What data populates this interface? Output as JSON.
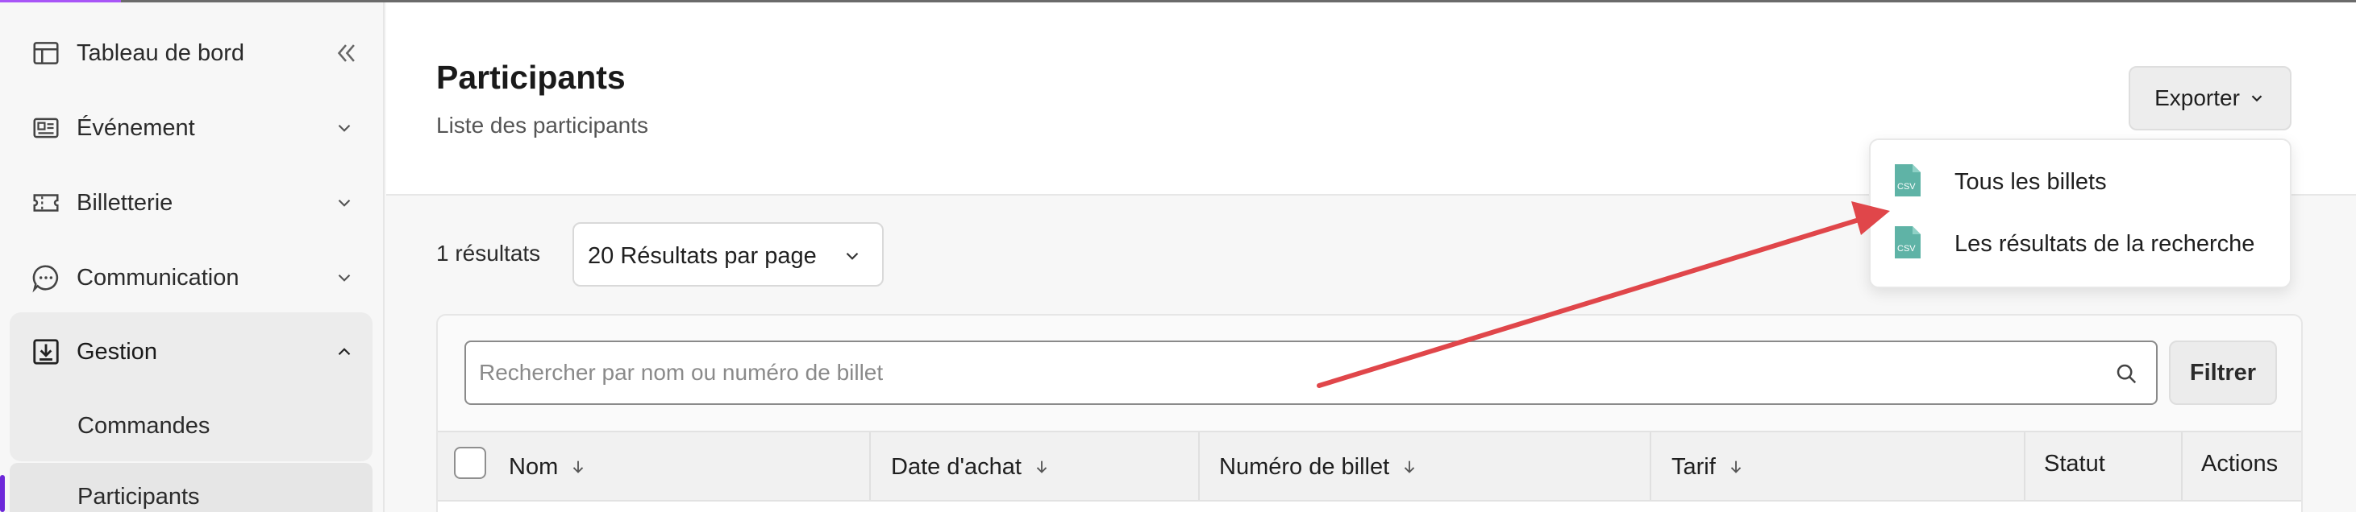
{
  "sidebar": {
    "items": [
      {
        "label": "Tableau de bord",
        "icon": "layout-icon"
      },
      {
        "label": "Événement",
        "icon": "id-card-icon"
      },
      {
        "label": "Billetterie",
        "icon": "ticket-icon"
      },
      {
        "label": "Communication",
        "icon": "chat-icon"
      },
      {
        "label": "Gestion",
        "icon": "download-box-icon"
      }
    ],
    "sub_items": [
      {
        "label": "Commandes"
      },
      {
        "label": "Participants"
      }
    ]
  },
  "header": {
    "title": "Participants",
    "subtitle": "Liste des participants",
    "export_label": "Exporter"
  },
  "export_menu": {
    "items": [
      {
        "label": "Tous les billets",
        "icon": "csv-file-icon"
      },
      {
        "label": "Les résultats de la recherche",
        "icon": "csv-file-icon"
      }
    ],
    "icon_text": "CSV"
  },
  "results": {
    "count_label": "1 résultats",
    "per_page_label": "20 Résultats par page"
  },
  "search": {
    "placeholder": "Rechercher par nom ou numéro de billet",
    "filter_label": "Filtrer"
  },
  "table": {
    "columns": [
      {
        "label": "Nom",
        "sortable": true
      },
      {
        "label": "Date d'achat",
        "sortable": true
      },
      {
        "label": "Numéro de billet",
        "sortable": true
      },
      {
        "label": "Tarif",
        "sortable": true
      },
      {
        "label": "Statut",
        "sortable": false
      },
      {
        "label": "Actions",
        "sortable": false
      }
    ]
  },
  "colors": {
    "accent": "#6d28d9",
    "csv_icon": "#5fb3a6",
    "annotation_arrow": "#e0464a"
  }
}
